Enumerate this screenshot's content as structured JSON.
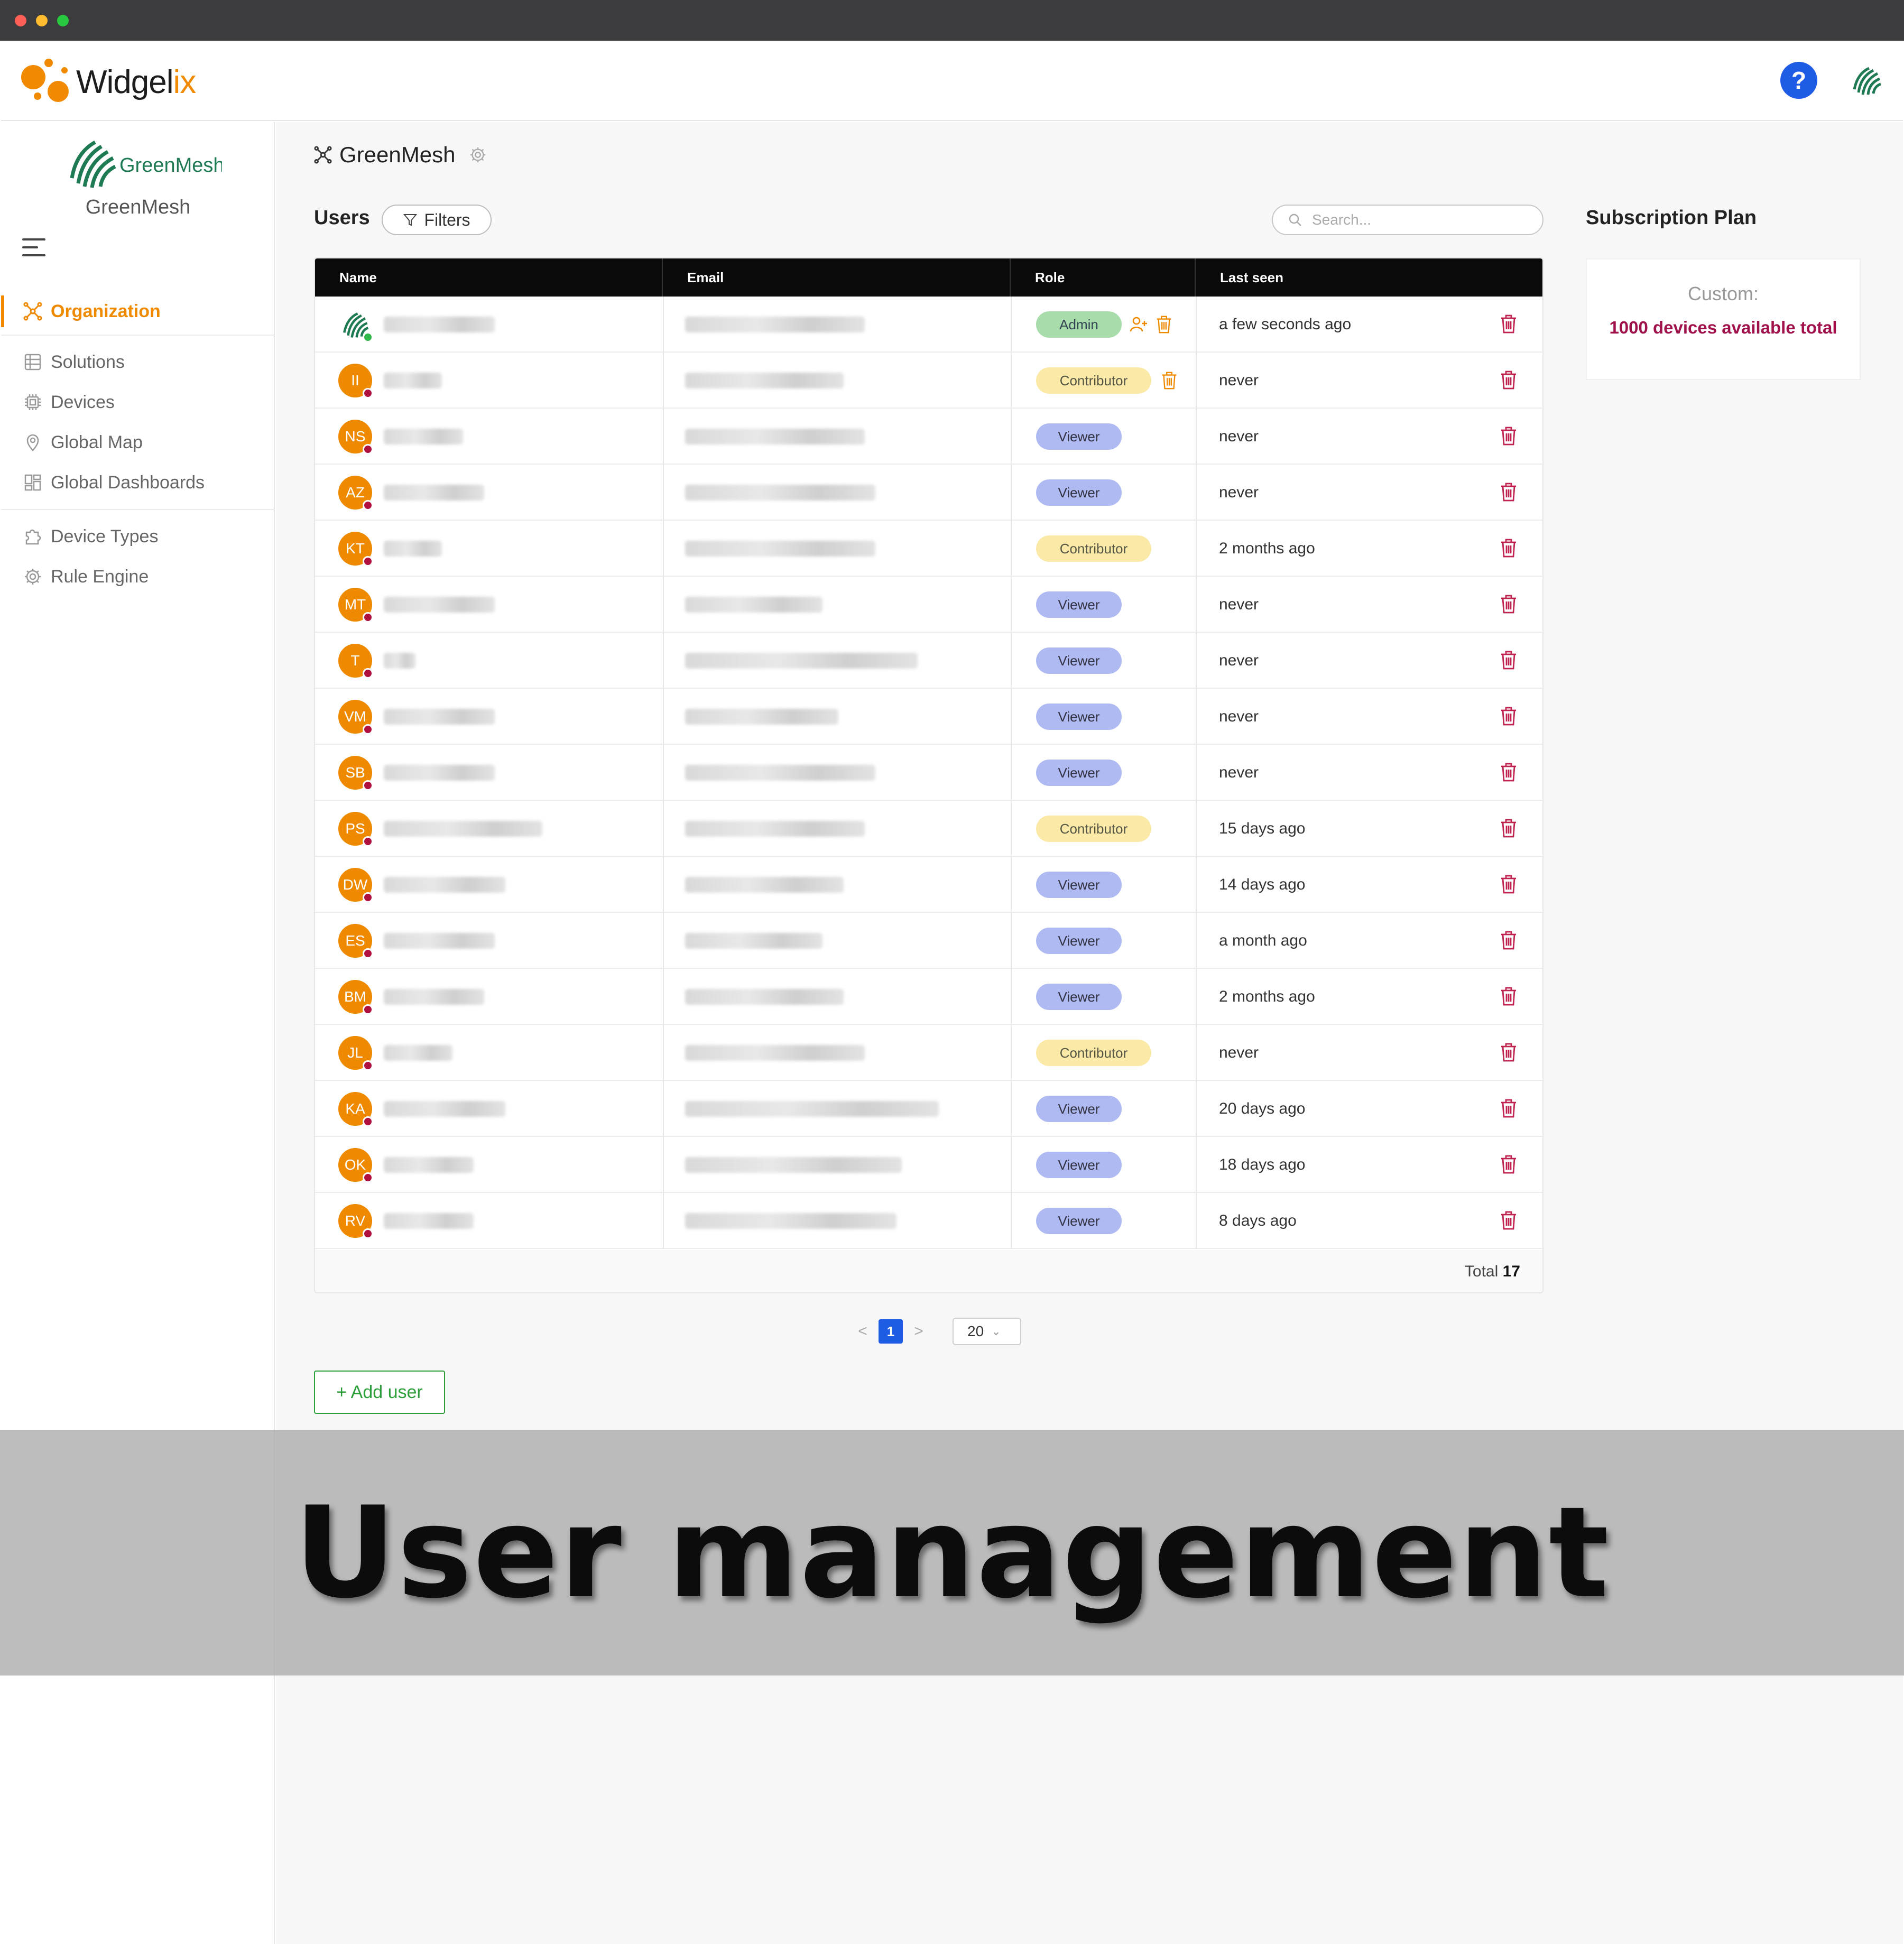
{
  "window": {
    "traffic_lights": [
      "close",
      "minimize",
      "maximize"
    ]
  },
  "app": {
    "brand_prefix": "Widgel",
    "brand_suffix": "ix",
    "help_label": "?",
    "accent_color": "#ef8a00",
    "primary_color": "#1f5ce6"
  },
  "sidebar": {
    "org_logo_text": "GreenMesh",
    "org_name": "GreenMesh",
    "items": [
      {
        "label": "Organization",
        "icon": "organization-icon",
        "active": true
      },
      {
        "label": "Solutions",
        "icon": "solutions-icon"
      },
      {
        "label": "Devices",
        "icon": "chip-icon"
      },
      {
        "label": "Global Map",
        "icon": "map-pin-icon"
      },
      {
        "label": "Global Dashboards",
        "icon": "dashboard-icon"
      },
      {
        "label": "Device Types",
        "icon": "puzzle-icon"
      },
      {
        "label": "Rule Engine",
        "icon": "gear-icon"
      }
    ]
  },
  "page": {
    "title": "GreenMesh",
    "users_heading": "Users",
    "filters_label": "Filters",
    "search_placeholder": "Search..."
  },
  "table": {
    "columns": [
      "Name",
      "Email",
      "Role",
      "Last seen"
    ],
    "rows": [
      {
        "initials": "",
        "logo": true,
        "role": "Admin",
        "last_seen": "a few seconds ago"
      },
      {
        "initials": "II",
        "role": "Contributor",
        "last_seen": "never"
      },
      {
        "initials": "NS",
        "role": "Viewer",
        "last_seen": "never"
      },
      {
        "initials": "AZ",
        "role": "Viewer",
        "last_seen": "never"
      },
      {
        "initials": "KT",
        "role": "Contributor",
        "last_seen": "2 months ago"
      },
      {
        "initials": "MT",
        "role": "Viewer",
        "last_seen": "never"
      },
      {
        "initials": "T",
        "role": "Viewer",
        "last_seen": "never"
      },
      {
        "initials": "VM",
        "role": "Viewer",
        "last_seen": "never"
      },
      {
        "initials": "SB",
        "role": "Viewer",
        "last_seen": "never"
      },
      {
        "initials": "PS",
        "role": "Contributor",
        "last_seen": "15 days ago"
      },
      {
        "initials": "DW",
        "role": "Viewer",
        "last_seen": "14 days ago"
      },
      {
        "initials": "ES",
        "role": "Viewer",
        "last_seen": "a month ago"
      },
      {
        "initials": "BM",
        "role": "Viewer",
        "last_seen": "2 months ago"
      },
      {
        "initials": "JL",
        "role": "Contributor",
        "last_seen": "never"
      },
      {
        "initials": "KA",
        "role": "Viewer",
        "last_seen": "20 days ago"
      },
      {
        "initials": "OK",
        "role": "Viewer",
        "last_seen": "18 days ago"
      },
      {
        "initials": "RV",
        "role": "Viewer",
        "last_seen": "8 days ago"
      }
    ],
    "total_label": "Total",
    "total_value": "17"
  },
  "pagination": {
    "prev": "<",
    "current": "1",
    "next": ">",
    "page_size": "20"
  },
  "add_user_label": "+ Add user",
  "subscription": {
    "heading": "Subscription Plan",
    "plan": "Custom:",
    "detail": "1000 devices available total"
  },
  "banner": {
    "text": "User management"
  }
}
